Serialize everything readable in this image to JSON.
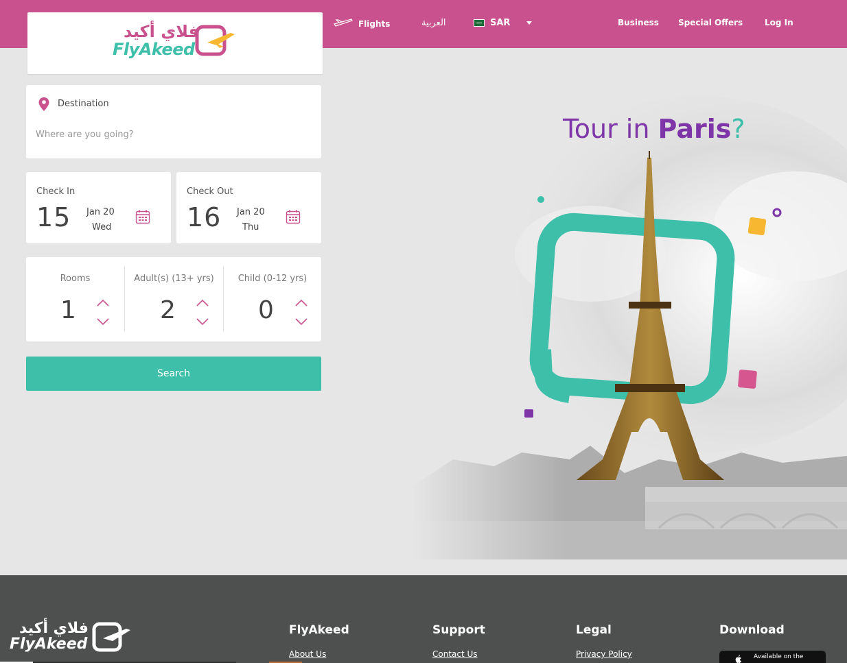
{
  "header": {
    "brand_arabic": "فلاي أكيد",
    "brand_latin": "FlyAkeed",
    "flights_label": "Flights",
    "language_label": "العربية",
    "currency_label": "SAR",
    "business_label": "Business",
    "special_offers_label": "Special Offers",
    "login_label": "Log In"
  },
  "search": {
    "destination_label": "Destination",
    "destination_placeholder": "Where are you going?",
    "destination_value": "",
    "check_in": {
      "label": "Check In",
      "day": "15",
      "month_year": "Jan 20",
      "weekday": "Wed"
    },
    "check_out": {
      "label": "Check Out",
      "day": "16",
      "month_year": "Jan 20",
      "weekday": "Thu"
    },
    "rooms": {
      "label": "Rooms",
      "value": "1"
    },
    "adults": {
      "label": "Adult(s) (13+ yrs)",
      "value": "2"
    },
    "children": {
      "label": "Child (0-12 yrs)",
      "value": "0"
    },
    "search_label": "Search"
  },
  "hero": {
    "title_prefix": "Tour in ",
    "title_city": "Paris",
    "title_suffix": "?"
  },
  "footer": {
    "brand_arabic": "فلاي أكيد",
    "brand_latin": "FlyAkeed",
    "columns": [
      {
        "heading": "FlyAkeed",
        "link": "About Us"
      },
      {
        "heading": "Support",
        "link": "Contact Us"
      },
      {
        "heading": "Legal",
        "link": "Privacy Policy"
      },
      {
        "heading": "Download"
      }
    ],
    "appstore_label": "Available on the"
  },
  "colors": {
    "brand_pink": "#c9528e",
    "brand_teal": "#3ebfaa",
    "brand_purple": "#7e35a8",
    "brand_yellow": "#f7b731",
    "footer_bg": "#4e504f"
  },
  "icons": [
    "plane-icon",
    "flag-icon",
    "chevron-down-icon",
    "location-pin-icon",
    "calendar-icon",
    "chevron-up-icon",
    "apple-icon"
  ]
}
